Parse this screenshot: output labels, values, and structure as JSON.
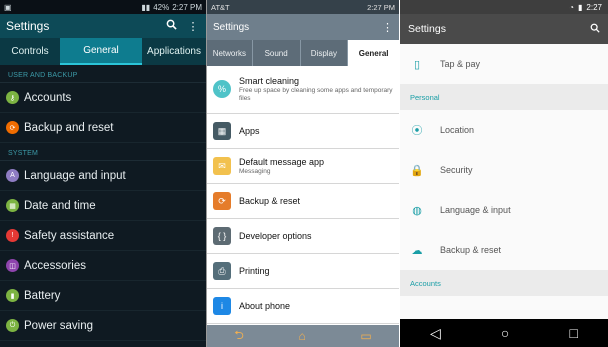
{
  "panel1": {
    "status_time": "2:27 PM",
    "status_battery": "42%",
    "title": "Settings",
    "tabs": [
      "Controls",
      "General",
      "Applications"
    ],
    "sections": [
      {
        "header": "USER AND BACKUP",
        "items": [
          {
            "label": "Accounts",
            "icon": "key-icon",
            "color": "#7cb342"
          },
          {
            "label": "Backup and reset",
            "icon": "backup-icon",
            "color": "#ef6c00"
          }
        ]
      },
      {
        "header": "SYSTEM",
        "items": [
          {
            "label": "Language and input",
            "icon": "language-icon",
            "color": "#8e7cc3"
          },
          {
            "label": "Date and time",
            "icon": "calendar-icon",
            "color": "#7cb342"
          },
          {
            "label": "Safety assistance",
            "icon": "safety-icon",
            "color": "#e53935"
          },
          {
            "label": "Accessories",
            "icon": "accessories-icon",
            "color": "#8e44ad"
          },
          {
            "label": "Battery",
            "icon": "battery-icon",
            "color": "#7cb342"
          },
          {
            "label": "Power saving",
            "icon": "power-icon",
            "color": "#7cb342"
          }
        ]
      }
    ]
  },
  "panel2": {
    "carrier": "AT&T",
    "status_time": "2:27 PM",
    "title": "Settings",
    "tabs": [
      "Networks",
      "Sound",
      "Display",
      "General"
    ],
    "items": [
      {
        "label": "Smart cleaning",
        "sub": "Free up space by cleaning some apps and temporary files",
        "icon": "smart-cleaning-icon",
        "color": "#4fc3c8"
      },
      {
        "label": "Apps",
        "sub": "",
        "icon": "apps-icon",
        "color": "#455a64"
      },
      {
        "label": "Default message app",
        "sub": "Messaging",
        "icon": "message-icon",
        "color": "#f2c14e"
      },
      {
        "label": "Backup & reset",
        "sub": "",
        "icon": "backup-icon",
        "color": "#e57c2a"
      },
      {
        "label": "Developer options",
        "sub": "",
        "icon": "developer-icon",
        "color": "#5d6b73"
      },
      {
        "label": "Printing",
        "sub": "",
        "icon": "printer-icon",
        "color": "#546e7a"
      },
      {
        "label": "About phone",
        "sub": "",
        "icon": "info-icon",
        "color": "#1e88e5"
      }
    ]
  },
  "panel3": {
    "status_time": "2:27",
    "title": "Settings",
    "items": [
      {
        "type": "item",
        "label": "Tap & pay",
        "icon": "tap-pay-icon"
      },
      {
        "type": "section",
        "label": "Personal"
      },
      {
        "type": "item",
        "label": "Location",
        "icon": "location-icon"
      },
      {
        "type": "item",
        "label": "Security",
        "icon": "lock-icon"
      },
      {
        "type": "item",
        "label": "Language & input",
        "icon": "globe-icon"
      },
      {
        "type": "item",
        "label": "Backup & reset",
        "icon": "cloud-upload-icon"
      },
      {
        "type": "section",
        "label": "Accounts"
      }
    ]
  }
}
